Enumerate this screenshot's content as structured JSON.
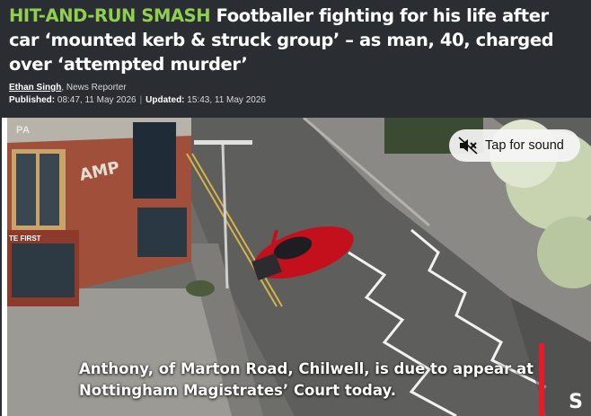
{
  "headline": {
    "kicker": "HIT-AND-RUN SMASH",
    "text": "Footballer fighting for his life after car ‘mounted kerb & struck group’ – as man, 40, charged over ‘attempted murder’"
  },
  "byline": {
    "author": "Ethan Singh",
    "role": ", News Reporter"
  },
  "dates": {
    "published_label": "Published:",
    "published": "08:47, 11 May 2026",
    "separator": "|",
    "updated_label": "Updated:",
    "updated": "15:43, 11 May 2026"
  },
  "video": {
    "agency": "PA",
    "sound_button_label": "Tap for sound",
    "caption": "Anthony, of Marton Road, Chilwell, is due to appear at Nottingham Magistrates’ Court today.",
    "sign_text": "AMP",
    "shop_sign": "TE FIRST",
    "brand_mark": "S"
  },
  "colors": {
    "kicker": "#8fd14f",
    "header_bg": "#2a2d31",
    "accent_red": "#e8192c"
  }
}
